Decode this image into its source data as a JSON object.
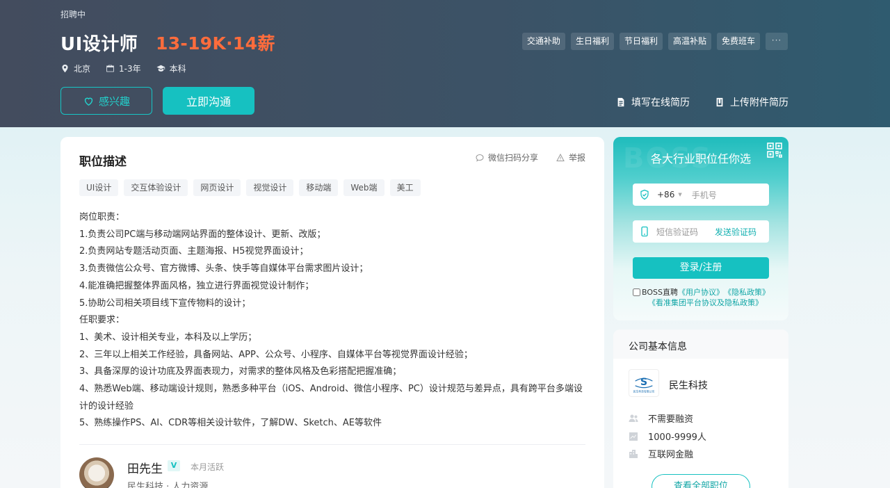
{
  "header": {
    "status": "招聘中",
    "job_title": "UI设计师",
    "salary": "13-19K·14薪",
    "meta": {
      "location": "北京",
      "experience": "1-3年",
      "education": "本科"
    },
    "welfare_tags": [
      "交通补助",
      "生日福利",
      "节日福利",
      "高温补贴",
      "免费班车"
    ],
    "welfare_more": "···",
    "interest_button": "感兴趣",
    "chat_button": "立即沟通",
    "online_resume": "填写在线简历",
    "upload_resume": "上传附件简历"
  },
  "job": {
    "section_title": "职位描述",
    "wechat_share": "微信扫码分享",
    "report": "举报",
    "skill_tags": [
      "UI设计",
      "交互体验设计",
      "网页设计",
      "视觉设计",
      "移动端",
      "Web端",
      "美工"
    ],
    "description_lines": [
      "岗位职责：",
      "1.负责公司PC端与移动端网站界面的整体设计、更新、改版；",
      "2.负责网站专题活动页面、主题海报、H5视觉界面设计；",
      "3.负责微信公众号、官方微博、头条、快手等自媒体平台需求图片设计；",
      "4.能准确把握整体界面风格，独立进行界面视觉设计制作；",
      "5.协助公司相关项目线下宣传物料的设计；",
      "任职要求：",
      "1、美术、设计相关专业，本科及以上学历；",
      "2、三年以上相关工作经验，具备网站、APP、公众号、小程序、自媒体平台等视觉界面设计经验；",
      "3、具备深厚的设计功底及界面表现力，对需求的整体风格及色彩搭配把握准确；",
      "4、熟悉Web端、移动端设计规则，熟悉多种平台（iOS、Android、微信小程序、PC）设计规范与差异点，具有跨平台多端设计的设计经验",
      "5、熟练操作PS、AI、CDR等相关设计软件，了解DW、Sketch、AE等软件"
    ],
    "recruiter": {
      "name": "田先生",
      "badge": "V",
      "active": "本月活跃",
      "company_title": "民生科技 · 人力资源"
    }
  },
  "login": {
    "watermark": "BOSS",
    "title": "各大行业职位任你选",
    "country_code": "+86",
    "phone_placeholder": "手机号",
    "code_placeholder": "短信验证码",
    "send_code": "发送验证码",
    "submit": "登录/注册",
    "agree_prefix": "BOSS直聘",
    "user_agreement": "《用户协议》",
    "privacy_policy": "《隐私政策》",
    "group_policy": "《看准集团平台协议及隐私政策》"
  },
  "company": {
    "section_title": "公司基本信息",
    "name": "民生科技",
    "logo_caption": "民生科技有限公司",
    "funding": "不需要融资",
    "size": "1000-9999人",
    "industry": "互联网金融",
    "all_jobs_button": "查看全部职位"
  },
  "colors": {
    "accent": "#16c1c1",
    "salary": "#ff6c3c",
    "header_bg": "#3c5266"
  }
}
